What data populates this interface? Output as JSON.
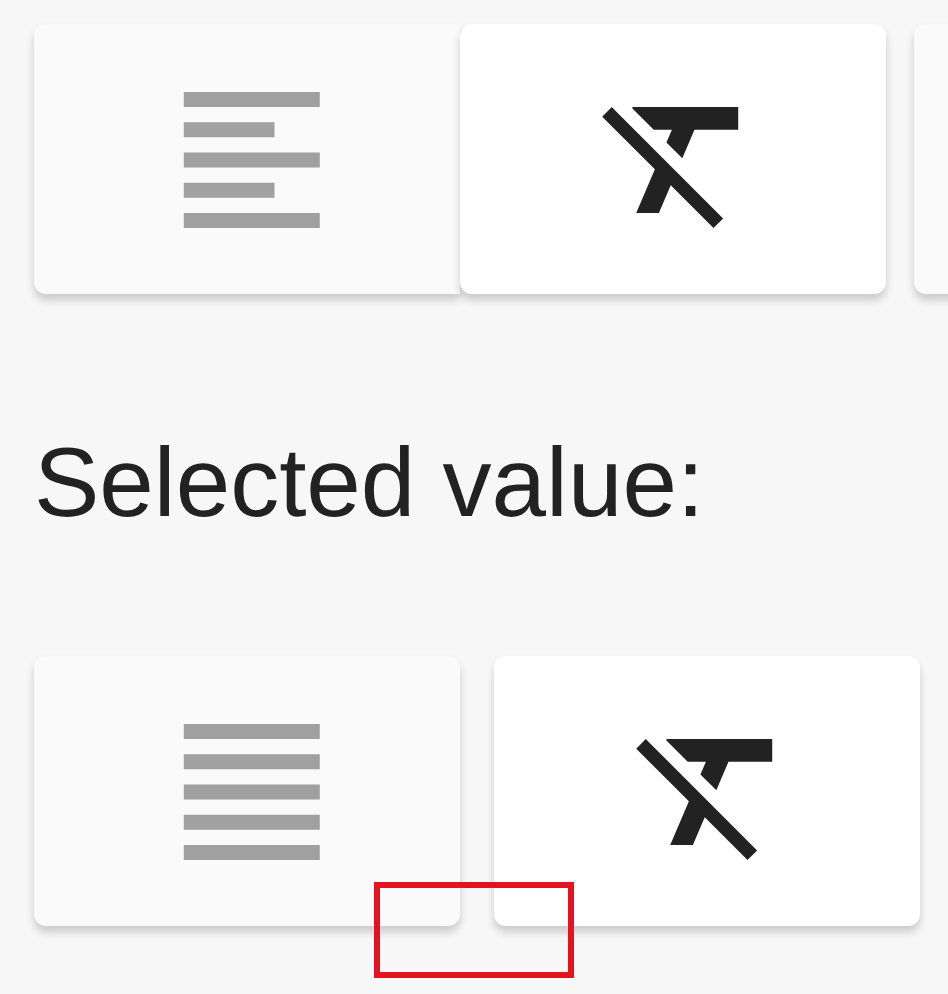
{
  "toggle_group_top": [
    {
      "kind": "align-left",
      "selected": false
    },
    {
      "kind": "clear-format",
      "selected": true
    },
    {
      "kind": "blank"
    }
  ],
  "label": "Selected value:",
  "toggle_group_bottom": [
    {
      "kind": "align-justify",
      "selected": false
    },
    {
      "kind": "clear-format",
      "selected": true
    }
  ],
  "highlight": {
    "color": "#e3141f"
  }
}
